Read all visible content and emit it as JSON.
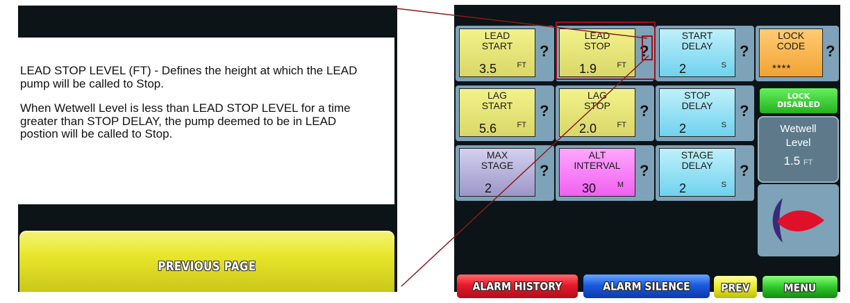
{
  "help": {
    "paragraph1": "LEAD STOP LEVEL (FT) - Defines the height at which the LEAD pump will be called to Stop.",
    "paragraph2": "When Wetwell Level is less than LEAD STOP LEVEL for a time greater than STOP DELAY, the pump deemed to be in LEAD postion will be called to Stop.",
    "previous_page": "PREVIOUS PAGE"
  },
  "tiles": {
    "lead_start": {
      "label1": "LEAD",
      "label2": "START",
      "value": "3.5",
      "unit": "FT"
    },
    "lead_stop": {
      "label1": "LEAD",
      "label2": "STOP",
      "value": "1.9",
      "unit": "FT"
    },
    "start_delay": {
      "label1": "START",
      "label2": "DELAY",
      "value": "2",
      "unit": "S"
    },
    "lock_code": {
      "label1": "LOCK",
      "label2": "CODE",
      "value": "****"
    },
    "lag_start": {
      "label1": "LAG",
      "label2": "START",
      "value": "5.6",
      "unit": "FT"
    },
    "lag_stop": {
      "label1": "LAG",
      "label2": "STOP",
      "value": "2.0",
      "unit": "FT"
    },
    "stop_delay": {
      "label1": "STOP",
      "label2": "DELAY",
      "value": "2",
      "unit": "S"
    },
    "max_stage": {
      "label1": "MAX",
      "label2": "STAGE",
      "value": "2"
    },
    "alt_interval": {
      "label1": "ALT",
      "label2": "INTERVAL",
      "value": "30",
      "unit": "M"
    },
    "stage_delay": {
      "label1": "STAGE",
      "label2": "DELAY",
      "value": "2",
      "unit": "S"
    }
  },
  "help_mark": "?",
  "lock_status": {
    "line1": "LOCK",
    "line2": "DISABLED"
  },
  "wetwell": {
    "line1": "Wetwell",
    "line2": "Level",
    "value": "1.5",
    "unit": "FT"
  },
  "buttons": {
    "alarm_history": "ALARM HISTORY",
    "alarm_silence": "ALARM SILENCE",
    "prev": "PREV",
    "menu": "MENU"
  },
  "colors": {
    "callout_line": "#8b1a1a",
    "alarm_red": "#e8182a",
    "alarm_blue": "#1a5ae0",
    "prev_yellow": "#eaea2a",
    "menu_green": "#2ec82a"
  },
  "icons": [
    "question-mark-icon",
    "pump-logo-icon"
  ]
}
